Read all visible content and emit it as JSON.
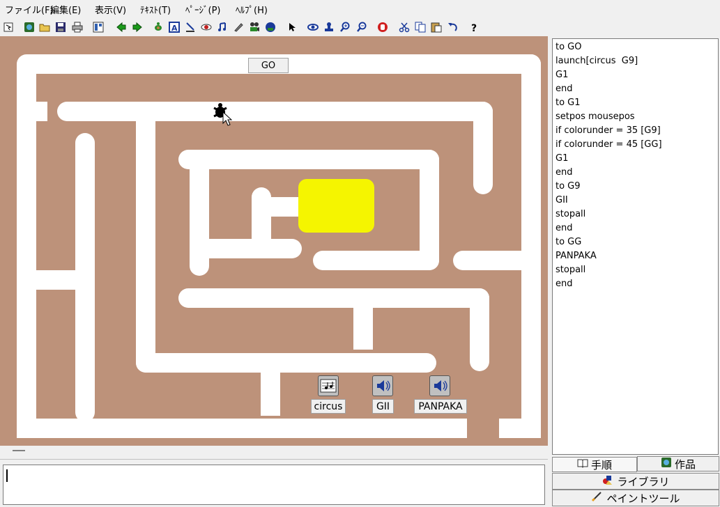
{
  "menu": [
    {
      "label": "ファイル(F)"
    },
    {
      "label": "編集(E)"
    },
    {
      "label": "表示(V)"
    },
    {
      "label": "ﾃｷｽﾄ(T)"
    },
    {
      "label": "ﾍﾟｰｼﾞ(P)"
    },
    {
      "label": "ﾍﾙﾌﾟ(H)"
    }
  ],
  "toolbar_icons": [
    "select-arrow-icon",
    "new-project-icon",
    "open-folder-icon",
    "save-icon",
    "print-icon",
    "page-layout-icon",
    "back-arrow-icon",
    "forward-arrow-icon",
    "turtle-icon",
    "text-box-icon",
    "paint-icon",
    "eye-shape-icon",
    "music-icon",
    "pen-icon",
    "movie-icon",
    "record-icon",
    "pointer-icon",
    "eye-icon",
    "stamp-icon",
    "zoom-in-icon",
    "zoom-out-icon",
    "stop-hand-icon",
    "cut-icon",
    "copy-icon",
    "paste-icon",
    "undo-icon",
    "help-icon"
  ],
  "canvas": {
    "go_button": "GO",
    "assets": [
      {
        "label": "circus",
        "icon": "music-score-icon"
      },
      {
        "label": "GII",
        "icon": "speaker-icon"
      },
      {
        "label": "PANPAKA",
        "icon": "speaker-icon"
      }
    ],
    "colors": {
      "maze_wall": "#bd927a",
      "path": "#ffffff",
      "goal": "#f5f500"
    }
  },
  "code_lines": [
    "to GO",
    "launch[circus  G9]",
    "G1",
    "end",
    "to G1",
    "setpos mousepos",
    "if colorunder = 35 [G9]",
    "if colorunder = 45 [GG]",
    "G1",
    "end",
    "to G9",
    "GII",
    "stopall",
    "end",
    "to GG",
    "PANPAKA",
    "stopall",
    "end"
  ],
  "tabs": [
    {
      "label": "手順",
      "icon": "book-icon",
      "active": true
    },
    {
      "label": "作品",
      "icon": "globe-icon",
      "active": false
    }
  ],
  "panel_buttons": [
    {
      "label": "ライブラリ",
      "icon": "library-shapes-icon"
    },
    {
      "label": "ペイントツール",
      "icon": "paintbrush-icon"
    }
  ],
  "command_center": {
    "value": ""
  }
}
